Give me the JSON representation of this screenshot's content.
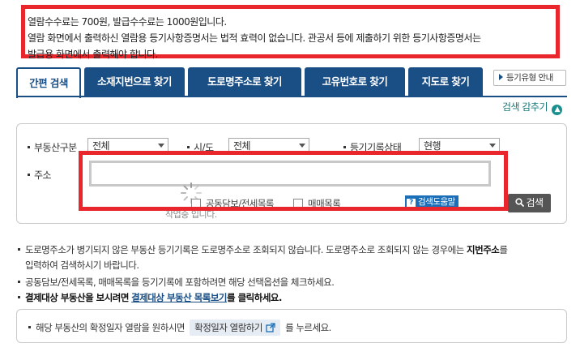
{
  "notice": {
    "lines": [
      "열람수수료는 700원, 발급수수료는 1000원입니다.",
      "열람 화면에서 출력하신 열람용 등기사항증명서는 법적 효력이 없습니다. 관공서 등에 제출하기 위한 등기사항증명서는",
      "발급용 화면에서 출력해야 합니다."
    ]
  },
  "tabs": [
    {
      "label": "간편 검색"
    },
    {
      "label": "소재지번으로 찾기"
    },
    {
      "label": "도로명주소로 찾기"
    },
    {
      "label": "고유번호로 찾기"
    },
    {
      "label": "지도로 찾기"
    }
  ],
  "guide_button": "등기유형 안내",
  "collapse_label": "검색 감추기",
  "search_form": {
    "property_type_label": "부동산구분",
    "property_type_value": "전체",
    "region_label": "시/도",
    "region_value": "전체",
    "status_label": "등기기록상태",
    "status_value": "현행",
    "address_label": "주소",
    "address_value": "",
    "option_joint": "공동담보/전세목록",
    "option_trade": "매매목록",
    "help_label": "검색도움말",
    "search_label": "검색",
    "ghost_text": "작업중 입니다."
  },
  "info": {
    "line1": "도로명주소가 병기되지 않은 부동산 등기기록은 도로명주소로 조회되지 않습니다. 도로명주소로 조회되지 않는 경우에는",
    "line1_bold": "지번주소",
    "line1_end": "를",
    "line2": "입력하여 검색하시기 바랍니다.",
    "line3": "공동담보/전세목록, 매매목록을 등기기록에 포함하려면 해당 선택옵션을 체크하세요.",
    "line4_bold": "결제대상 부동산을 보시려면",
    "line4_link": "결제대상 부동산 목록보기",
    "line4_end": "를 클릭하세요."
  },
  "confirm": {
    "prefix": "해당 부동산의 확정일자 열람을 원하시면",
    "button": "확정일자 열람하기",
    "suffix": "를 누르세요."
  },
  "colors": {
    "primary": "#1a4f86",
    "highlight_border": "#e8262b"
  }
}
